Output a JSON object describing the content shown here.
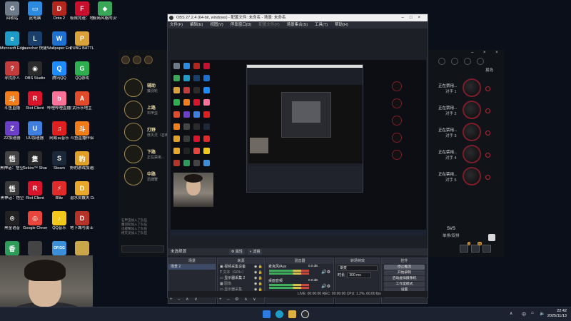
{
  "desktop_icons": [
    {
      "label": "回收站",
      "color": "#6c7a8a",
      "glyph": "♻"
    },
    {
      "label": "此电脑",
      "color": "#2c8be0",
      "glyph": "▭"
    },
    {
      "label": "Dota 2",
      "color": "#b3261e",
      "glyph": "D"
    },
    {
      "label": "极限竞速：地平线 5",
      "color": "#c8102e",
      "glyph": "F"
    },
    {
      "label": "极简风格的汉化程序",
      "color": "#3aa657",
      "glyph": "◆"
    },
    {
      "label": "Microsoft Edge",
      "color": "#1d9cc7",
      "glyph": "e"
    },
    {
      "label": "launcher 快捷方式",
      "color": "#1a3f6b",
      "glyph": "L"
    },
    {
      "label": "Wallpaper Engine: ...",
      "color": "#1d6fd0",
      "glyph": "W"
    },
    {
      "label": "PUBG BATTLEGR...",
      "color": "#d8a13a",
      "glyph": "P"
    },
    {
      "label": "寻找办人",
      "color": "#c43b3b",
      "glyph": "?"
    },
    {
      "label": "OBS Studio",
      "color": "#2b2b2b",
      "glyph": "◉"
    },
    {
      "label": "腾讯QQ",
      "color": "#1e8bff",
      "glyph": "Q"
    },
    {
      "label": "QQ游戏",
      "color": "#2dae4f",
      "glyph": "G"
    },
    {
      "label": "斗鱼直播",
      "color": "#f07c1a",
      "glyph": "斗"
    },
    {
      "label": "Riot Client",
      "color": "#d8152b",
      "glyph": "R"
    },
    {
      "label": "哔哩哔哩直播姬",
      "color": "#fb7299",
      "glyph": "b"
    },
    {
      "label": "武乐乐地主",
      "color": "#e04b2b",
      "glyph": "A"
    },
    {
      "label": "ZZ加速器",
      "color": "#6b3fc7",
      "glyph": "Z"
    },
    {
      "label": "UU加速器",
      "color": "#3f7fe0",
      "glyph": "U"
    },
    {
      "label": "网易云音乐",
      "color": "#e02020",
      "glyph": "♫"
    },
    {
      "label": "斗鱼直播伴侣",
      "color": "#f07c1a",
      "glyph": "斗"
    },
    {
      "label": "黑神话：悟空 性能测试工具",
      "color": "#444",
      "glyph": "悟"
    },
    {
      "label": "Sekiro™ Shadow...",
      "color": "#2a2a2a",
      "glyph": "隻"
    },
    {
      "label": "Steam",
      "color": "#1b2838",
      "glyph": "S"
    },
    {
      "label": "野豹游戏加速器",
      "color": "#e0a028",
      "glyph": "豹"
    },
    {
      "label": "黑神话：悟空",
      "color": "#3a3a3a",
      "glyph": "悟"
    },
    {
      "label": "Riot Client",
      "color": "#d8152b",
      "glyph": "R"
    },
    {
      "label": "Blitz",
      "color": "#e02b2b",
      "glyph": "⚡"
    },
    {
      "label": "潜水员戴夫 DAVE T...",
      "color": "#e8a92a",
      "glyph": "D"
    },
    {
      "label": "黑金语音",
      "color": "#222",
      "glyph": "⊙"
    },
    {
      "label": "Google Chrome",
      "color": "#e8453c",
      "glyph": "◎"
    },
    {
      "label": "QQ音乐",
      "color": "#f2c81b",
      "glyph": "♪"
    },
    {
      "label": "地下城与勇士：创新世纪",
      "color": "#b4342a",
      "glyph": "D"
    },
    {
      "label": "香肠电竞加速器",
      "color": "#2d9c5a",
      "glyph": "香"
    },
    {
      "label": "",
      "color": "#444",
      "glyph": ""
    },
    {
      "label": "",
      "color": "#3a8fd8",
      "glyph": "OP.GG"
    },
    {
      "label": "",
      "color": "#c9a64a",
      "glyph": ""
    },
    {
      "label": "",
      "color": "#111",
      "glyph": "♪"
    }
  ],
  "client": {
    "roles": [
      {
        "title": "辅助",
        "sub": "魔羽轮"
      },
      {
        "title": "上路",
        "sub": "石甲虫"
      },
      {
        "title": "打野",
        "sub": "修灭灵（召唤师）"
      },
      {
        "title": "下路",
        "sub": "正在禁用..."
      },
      {
        "title": "中路",
        "sub": "迅捷蟹"
      }
    ],
    "right_header": "孤岛",
    "right_rows": [
      {
        "t1": "正在禁用...",
        "t2": "对手 1"
      },
      {
        "t1": "正在禁用...",
        "t2": "对手 2"
      },
      {
        "t1": "正在禁用...",
        "t2": "对手 3"
      },
      {
        "t1": "正在禁用...",
        "t2": "对手 4"
      },
      {
        "t1": "正在禁用...",
        "t2": "对手 5"
      }
    ],
    "mode_label": "SVS",
    "mode_sub": "单排/双排",
    "chat_lines": [
      "石甲虫加入了队伍",
      "魔羽轮加入了队伍",
      "迅捷蟹加入了队伍",
      "修灭灵加入了队伍"
    ]
  },
  "obs": {
    "title": "OBS 27.2.4 (64-bit, windows) - 配置文件: 未命名 - 场景: 未命名",
    "menu": [
      "文件(F)",
      "编辑(E)",
      "视图(V)",
      "停靠窗口(D)",
      "配置文件(P)",
      "场景集合(S)",
      "工具(T)",
      "帮助(H)"
    ],
    "no_source_label": "未选择源",
    "properties_button": "属性",
    "filters_button": "滤镜",
    "docks": {
      "scenes": {
        "header": "场景",
        "items": [
          "场景 2"
        ]
      },
      "sources": {
        "header": "来源",
        "items": [
          "视频采集设备",
          "文本（GDI+）",
          "显示器采集 2",
          "图像",
          "显示器采集"
        ]
      },
      "mixer": {
        "header": "混音器",
        "channels": [
          {
            "name": "麦克风/Aux",
            "level": "0.0 dB"
          },
          {
            "name": "桌面音频",
            "level": "0.0 dB"
          }
        ]
      },
      "transitions": {
        "header": "转场特效",
        "type": "渐变",
        "duration_label": "时长",
        "duration_value": "300 ms"
      },
      "controls": {
        "header": "控件",
        "buttons": [
          "停止推流",
          "开始录制",
          "启动虚拟摄像机",
          "工作室模式",
          "设置",
          "退出"
        ]
      }
    },
    "status": "LIVE: 00:00:00   REC: 00:00:00   CPU: 1.2%, 60.00 fps"
  },
  "taskbar": {
    "time": "22:42",
    "date": "2025/11/13",
    "ime": "中",
    "lang": "英"
  }
}
